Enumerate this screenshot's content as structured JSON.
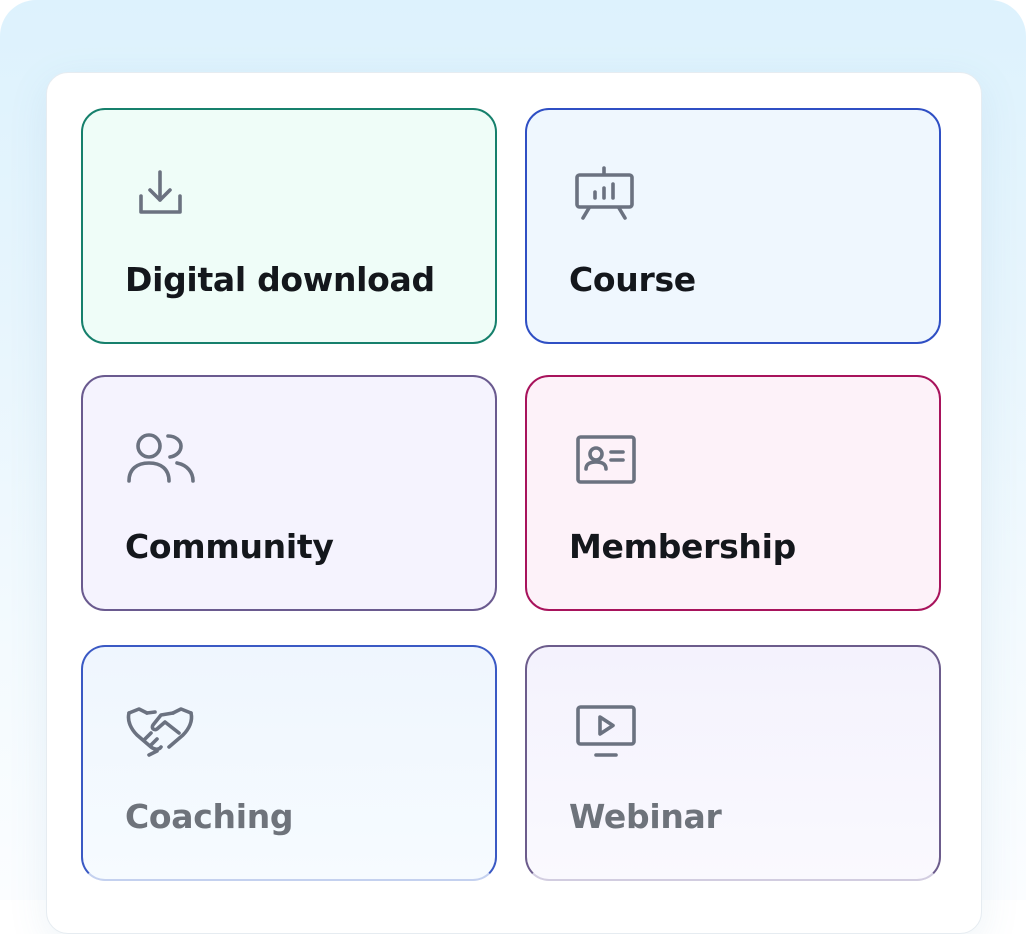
{
  "product_types": [
    {
      "id": "digital-download",
      "label": "Digital download",
      "icon": "download-icon",
      "accent": "#16806c",
      "background": "#effdf8"
    },
    {
      "id": "course",
      "label": "Course",
      "icon": "presentation-chart-icon",
      "accent": "#2f4fc4",
      "background": "#eff7fe"
    },
    {
      "id": "community",
      "label": "Community",
      "icon": "users-icon",
      "accent": "#6a5a8f",
      "background": "#f5f3fe"
    },
    {
      "id": "membership",
      "label": "Membership",
      "icon": "id-card-icon",
      "accent": "#a8135c",
      "background": "#fdf2f9"
    },
    {
      "id": "coaching",
      "label": "Coaching",
      "icon": "handshake-icon",
      "accent": "#3050c2",
      "background": "#eff6fe"
    },
    {
      "id": "webinar",
      "label": "Webinar",
      "icon": "monitor-play-icon",
      "accent": "#6c5c8c",
      "background": "#f4f2fd"
    }
  ],
  "colors": {
    "icon_stroke": "#6b7280",
    "label_text": "#14171c",
    "backdrop": "#ddf2fd"
  }
}
